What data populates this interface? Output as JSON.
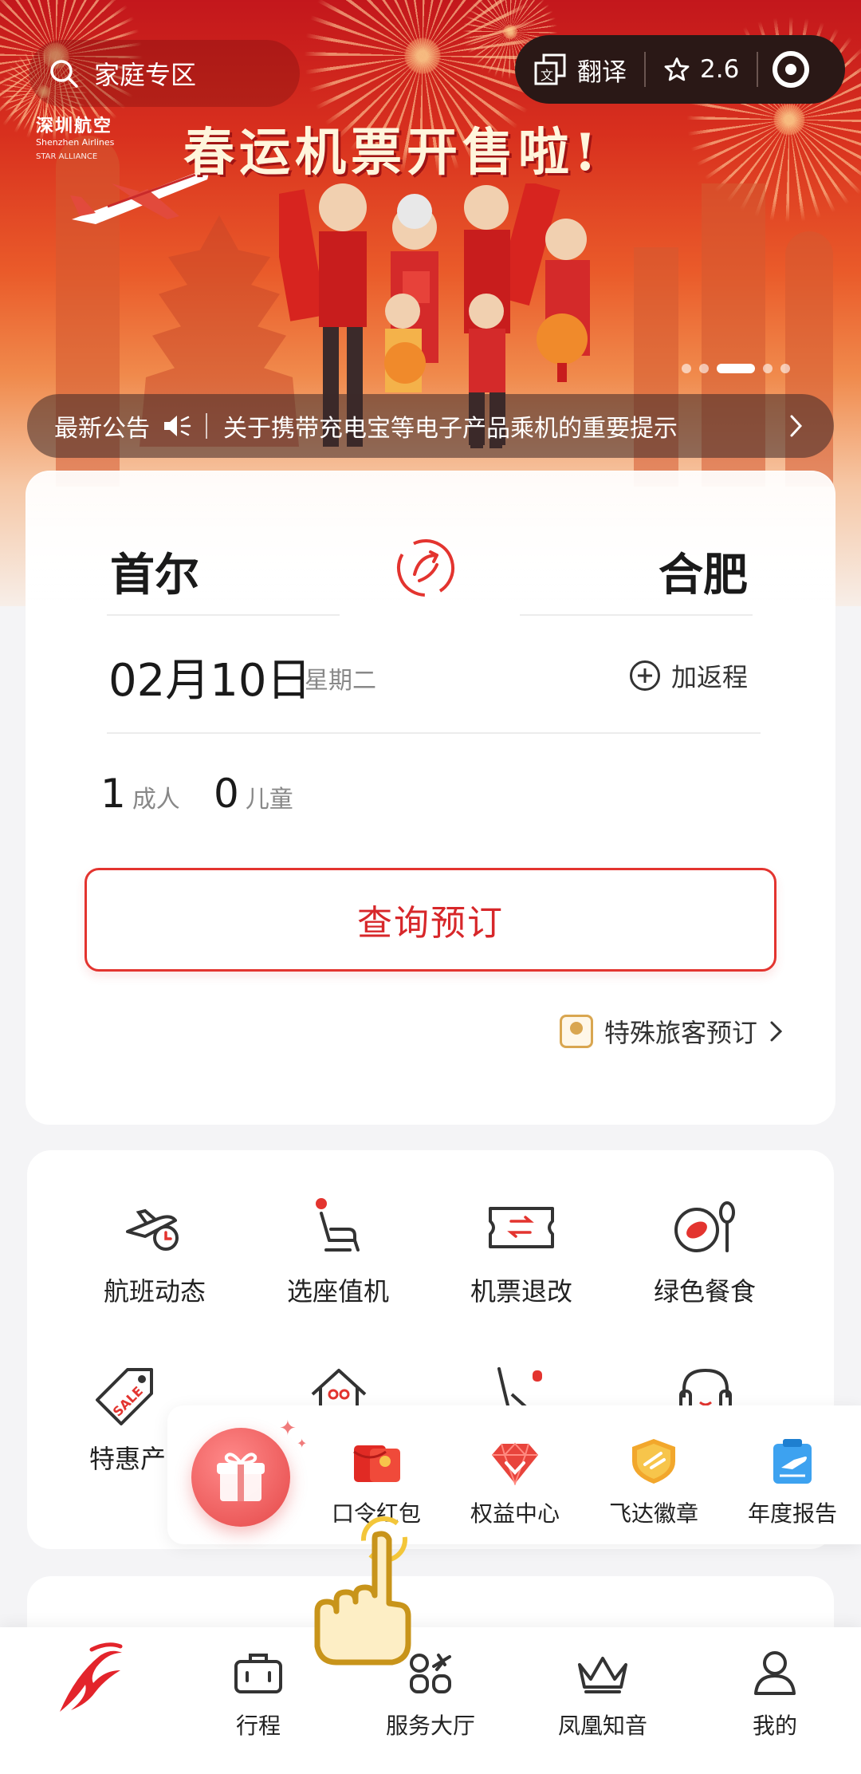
{
  "banner": {
    "headline": "春运机票开售啦!",
    "airline_cn": "深圳航空",
    "airline_en": "Shenzhen Airlines",
    "alliance": "STAR ALLIANCE",
    "active_slide": 3,
    "total_slides": 5
  },
  "search": {
    "placeholder": "家庭专区"
  },
  "toolbar": {
    "translate_label": "翻译",
    "rating": "2.6"
  },
  "notice": {
    "title": "最新公告",
    "text": "关于携带充电宝等电子产品乘机的重要提示"
  },
  "booking": {
    "from": "首尔",
    "to": "合肥",
    "date": "02月10日",
    "weekday": "星期二",
    "add_return": "加返程",
    "adults_count": "1",
    "adults_label": "成人",
    "children_count": "0",
    "children_label": "儿童",
    "query_button": "查询预订",
    "special_passenger": "特殊旅客预订"
  },
  "services": [
    {
      "label": "航班动态",
      "icon": "plane-clock-icon"
    },
    {
      "label": "选座值机",
      "icon": "seat-checkin-icon"
    },
    {
      "label": "机票退改",
      "icon": "ticket-icon"
    },
    {
      "label": "绿色餐食",
      "icon": "dining-icon"
    },
    {
      "label": "特惠产",
      "icon": "sale-tag-icon"
    }
  ],
  "float_bar": [
    {
      "label": "口令红包",
      "icon": "red-envelope-icon"
    },
    {
      "label": "权益中心",
      "icon": "diamond-icon"
    },
    {
      "label": "飞达徽章",
      "icon": "badge-icon"
    },
    {
      "label": "年度报告",
      "icon": "report-icon"
    }
  ],
  "nav": [
    {
      "label": "",
      "icon": "phoenix-logo-icon"
    },
    {
      "label": "行程",
      "icon": "suitcase-icon"
    },
    {
      "label": "服务大厅",
      "icon": "services-icon"
    },
    {
      "label": "凤凰知音",
      "icon": "crown-icon"
    },
    {
      "label": "我的",
      "icon": "person-icon"
    }
  ],
  "colors": {
    "brand_red": "#e3342f",
    "banner_red": "#c3171c",
    "gold": "#d9a650"
  }
}
